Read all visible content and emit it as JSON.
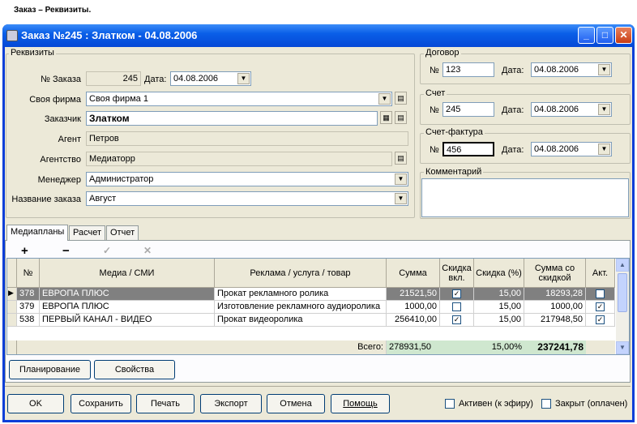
{
  "caption": "Заказ – Реквизиты.",
  "window": {
    "title": "Заказ №245 : Златком - 04.08.2006"
  },
  "rekv": {
    "group": "Реквизиты",
    "order_no_label": "№ Заказа",
    "order_no": "245",
    "date_label": "Дата:",
    "date": "04.08.2006",
    "firm_label": "Своя фирма",
    "firm": "Своя фирма 1",
    "client_label": "Заказчик",
    "client": "Златком",
    "agent_label": "Агент",
    "agent": "Петров",
    "agency_label": "Агентство",
    "agency": "Медиаторр",
    "manager_label": "Менеджер",
    "manager": "Администратор",
    "name_label": "Название заказа",
    "name": "Август"
  },
  "contract": {
    "group": "Договор",
    "no_label": "№",
    "no": "123",
    "date_label": "Дата:",
    "date": "04.08.2006"
  },
  "invoice": {
    "group": "Счет",
    "no_label": "№",
    "no": "245",
    "date_label": "Дата:",
    "date": "04.08.2006"
  },
  "facture": {
    "group": "Счет-фактура",
    "no_label": "№",
    "no": "456",
    "date_label": "Дата:",
    "date": "04.08.2006"
  },
  "comment": {
    "group": "Комментарий"
  },
  "tabs": [
    "Медиапланы",
    "Расчет",
    "Отчет"
  ],
  "toolbar": {
    "add": "+",
    "remove": "−",
    "ok": "✓",
    "cancel": "✕"
  },
  "grid": {
    "headers": [
      "№",
      "Медиа / СМИ",
      "Реклама / услуга / товар",
      "Сумма",
      "Скидка вкл.",
      "Скидка (%)",
      "Сумма со скидкой",
      "Акт."
    ],
    "rows": [
      {
        "no": "378",
        "media": "ЕВРОПА ПЛЮС",
        "service": "Прокат рекламного ролика",
        "sum": "21521,50",
        "disc_on": "✓",
        "disc": "15,00",
        "sum_disc": "18293,28",
        "act": ""
      },
      {
        "no": "379",
        "media": "ЕВРОПА ПЛЮС",
        "service": "Изготовление рекламного аудиоролика",
        "sum": "1000,00",
        "disc_on": "",
        "disc": "15,00",
        "sum_disc": "1000,00",
        "act": "✓"
      },
      {
        "no": "538",
        "media": "ПЕРВЫЙ КАНАЛ - ВИДЕО",
        "service": "Прокат видеоролика",
        "sum": "256410,00",
        "disc_on": "✓",
        "disc": "15,00",
        "sum_disc": "217948,50",
        "act": "✓"
      }
    ],
    "total_label": "Всего:",
    "total_sum": "278931,50",
    "total_disc": "15,00%",
    "total_sum_disc": "237241,78"
  },
  "buttons": {
    "plan": "Планирование",
    "props": "Свойства",
    "ok": "OK",
    "save": "Сохранить",
    "print": "Печать",
    "export": "Экспорт",
    "cancel": "Отмена",
    "help": "Помощь"
  },
  "flags": {
    "active": "Активен (к эфиру)",
    "closed": "Закрыт (оплачен)"
  }
}
